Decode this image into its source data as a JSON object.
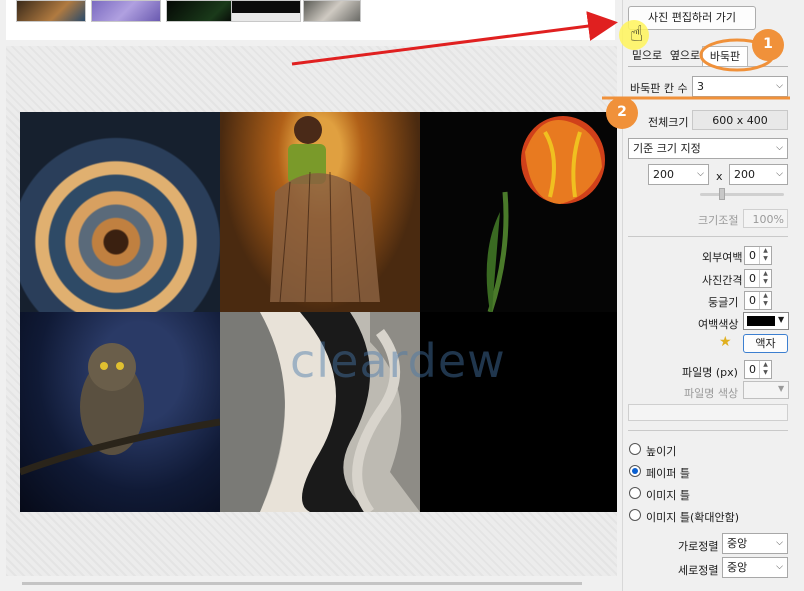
{
  "toolbar": {
    "go_edit_label": "사진 편집하러 가기"
  },
  "tabs": [
    {
      "label": "밑으로"
    },
    {
      "label": "옆으로"
    },
    {
      "label": "바둑판"
    }
  ],
  "grid": {
    "columns_label": "바둑판 칸 수",
    "columns_value": "3",
    "total_size_label": "전체크기",
    "total_size_value": "600 x 400",
    "size_mode": "기준 크기 지정",
    "width_value": "200",
    "x_sep": "x",
    "height_value": "200",
    "scale_label": "크기조절",
    "scale_value": "100%"
  },
  "spacing": {
    "outer_margin_label": "외부여백",
    "outer_margin_value": "0",
    "photo_gap_label": "사진간격",
    "photo_gap_value": "0",
    "rounding_label": "둥글기",
    "rounding_value": "0",
    "margin_color_label": "여백색상",
    "margin_color": "#000000",
    "frame_label": "액자",
    "filename_px_label": "파일명 (px)",
    "filename_px_value": "0",
    "filename_color_label": "파일명 색상"
  },
  "fit_options": [
    {
      "label": "높이기",
      "selected": false
    },
    {
      "label": "페이퍼 틀",
      "selected": true
    },
    {
      "label": "이미지 틀",
      "selected": false
    },
    {
      "label": "이미지 틀(확대안함)",
      "selected": false
    }
  ],
  "align": {
    "horizontal_label": "가로정렬",
    "horizontal_value": "중앙",
    "vertical_label": "세로정렬",
    "vertical_value": "중앙"
  },
  "annotations": {
    "step1": "1",
    "step2": "2",
    "accent": "#f0913a",
    "arrow_color": "#e02020"
  },
  "watermark": "cleardew"
}
